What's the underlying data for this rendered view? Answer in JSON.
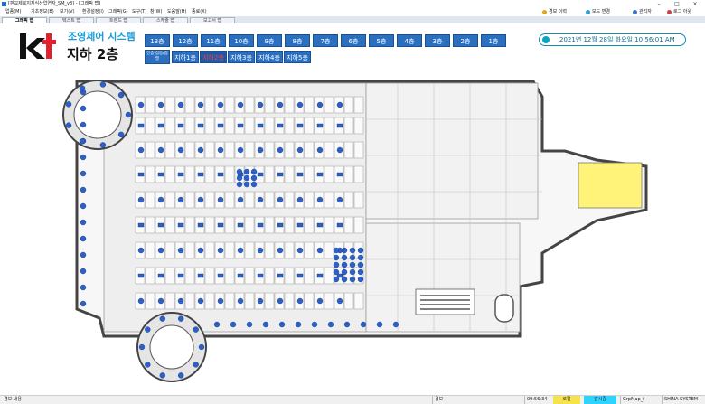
{
  "window": {
    "title": "[판교제로지지식산업연자_SM_v3] - [그래픽 맵]",
    "controls": [
      "–",
      "□",
      "×"
    ]
  },
  "menu": {
    "items": [
      "업종(M)",
      "기초정보(B)",
      "보기(V)",
      "환경설정(I)",
      "그래픽(G)",
      "도구(T)",
      "창(W)",
      "도움말(H)",
      "종료(X)"
    ],
    "right_buttons": [
      "경보 이력",
      "모드 변경",
      "관리자",
      "로그 아웃"
    ]
  },
  "tabs": [
    "그래픽 맵",
    "텍스트 맵",
    "트렌드 맵",
    "스케줄 맵",
    "보고서 맵"
  ],
  "header": {
    "logo_text": "kt",
    "system_title": "조영제어 시스템",
    "floor_title": "지하 2층"
  },
  "floors_row1": [
    "13층",
    "12층",
    "11층",
    "10층",
    "9층",
    "8층",
    "7층",
    "6층",
    "5층",
    "4층",
    "3층",
    "2층",
    "1층"
  ],
  "floors_row2": [
    "전층 점등/점멸",
    "지하1층",
    "지하2층",
    "지하3층",
    "지하4층",
    "지하5층"
  ],
  "active_floor": "지하2층",
  "clock": "2021년 12월 28일 화요일 10:56:01 AM",
  "status": {
    "left": "경보 내용",
    "alarm": "경보",
    "time": "09:56:34",
    "mode": "로컬",
    "monitoring": "감시중",
    "map": "GrpMap_f",
    "company": "SHINA SYSTEM"
  },
  "colors": {
    "floor_button": "#2b6fc0",
    "active_text": "#ff4040",
    "lamp": "#2e5fc4",
    "accent": "#1a9ad6"
  }
}
